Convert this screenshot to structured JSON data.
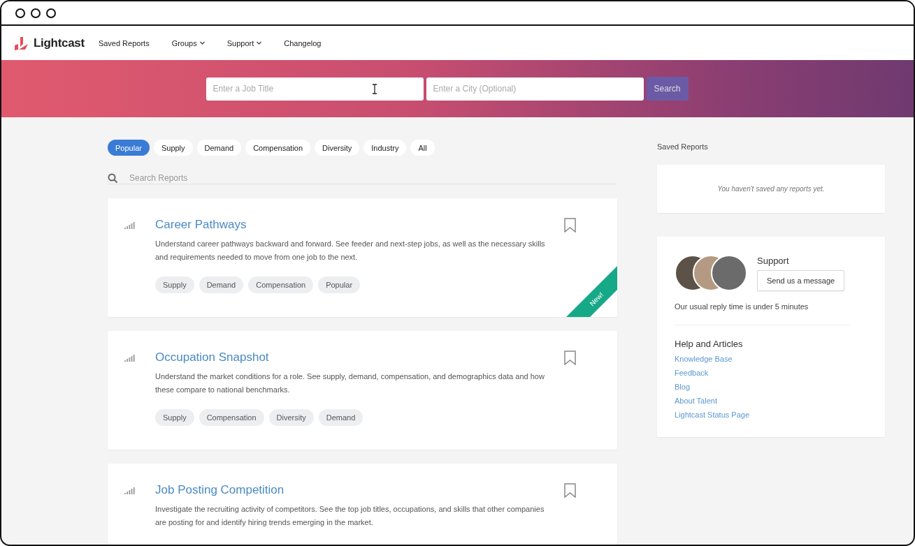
{
  "nav": {
    "brand": "Lightcast",
    "items": [
      {
        "label": "Saved Reports",
        "dropdown": false
      },
      {
        "label": "Groups",
        "dropdown": true
      },
      {
        "label": "Support",
        "dropdown": true
      },
      {
        "label": "Changelog",
        "dropdown": false
      }
    ]
  },
  "hero": {
    "job_field": {
      "placeholder": "Enter a Job Title"
    },
    "city_field": {
      "placeholder": "Enter a City (Optional)"
    },
    "button": "Search"
  },
  "filters": [
    {
      "label": "Popular",
      "selected": true
    },
    {
      "label": "Supply",
      "selected": false
    },
    {
      "label": "Demand",
      "selected": false
    },
    {
      "label": "Compensation",
      "selected": false
    },
    {
      "label": "Diversity",
      "selected": false
    },
    {
      "label": "Industry",
      "selected": false
    },
    {
      "label": "All",
      "selected": false
    }
  ],
  "report_search": {
    "placeholder": "Search Reports"
  },
  "reports": [
    {
      "title": "Career Pathways",
      "description": "Understand career pathways backward and forward. See feeder and next-step jobs, as well as the necessary skills and requirements needed to move from one job to the next.",
      "tags": [
        "Supply",
        "Demand",
        "Compensation",
        "Popular"
      ],
      "ribbon": "New!"
    },
    {
      "title": "Occupation Snapshot",
      "description": "Understand the market conditions for a role. See supply, demand, compensation, and demographics data and how these compare to national benchmarks.",
      "tags": [
        "Supply",
        "Compensation",
        "Diversity",
        "Demand"
      ]
    },
    {
      "title": "Job Posting Competition",
      "description": "Investigate the recruiting activity of competitors. See the top job titles, occupations, and skills that other companies are posting for and identify hiring trends emerging in the market."
    }
  ],
  "sidebar": {
    "saved_title": "Saved Reports",
    "saved_empty": "You haven't saved any reports yet.",
    "support_title": "Support",
    "support_button": "Send us a message",
    "reply_time": "Our usual reply time is under 5 minutes",
    "help_title": "Help and Articles",
    "links": [
      "Knowledge Base",
      "Feedback",
      "Blog",
      "About Talent",
      "Lightcast Status Page"
    ]
  }
}
